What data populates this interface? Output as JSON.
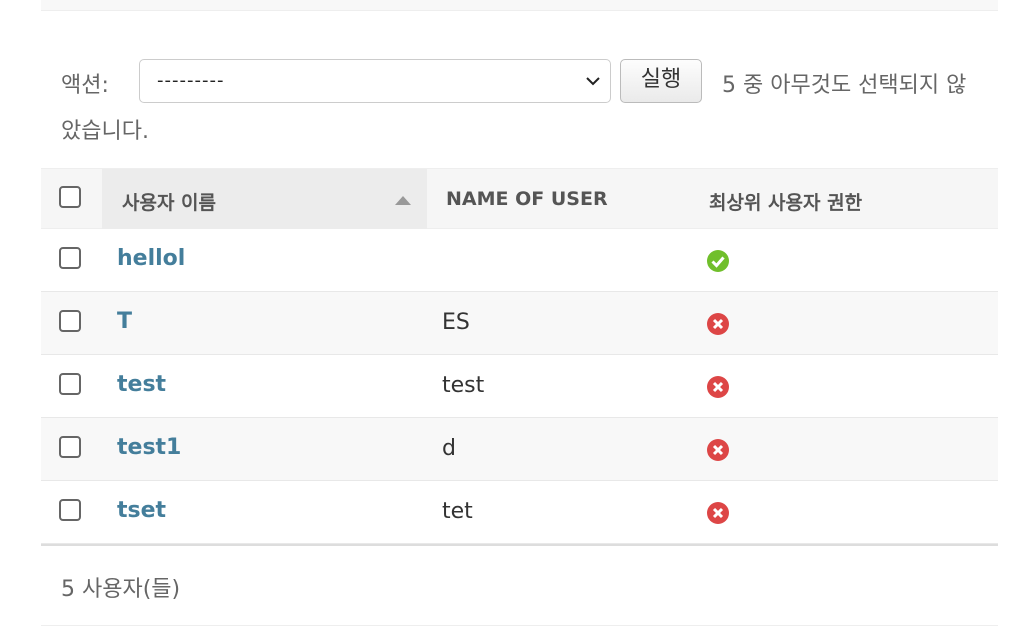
{
  "actions": {
    "label": "액션:",
    "select_value": "---------",
    "go_label": "실행",
    "selection_counter_line1": "5 중 아무것도 선택되지 않",
    "selection_counter_line2": "았습니다."
  },
  "table": {
    "columns": [
      "사용자 이름",
      "NAME OF USER",
      "최상위 사용자 권한"
    ],
    "sort_direction": "ascending",
    "rows": [
      {
        "username": "hellol",
        "name": "",
        "superuser": true
      },
      {
        "username": "T",
        "name": "ES",
        "superuser": false
      },
      {
        "username": "test",
        "name": "test",
        "superuser": false
      },
      {
        "username": "test1",
        "name": "d",
        "superuser": false
      },
      {
        "username": "tset",
        "name": "tet",
        "superuser": false
      }
    ]
  },
  "paginator": {
    "text": "5 사용자(들)"
  },
  "colors": {
    "link": "#447e9b",
    "yes": "#70bf2b",
    "no": "#dd4646"
  }
}
